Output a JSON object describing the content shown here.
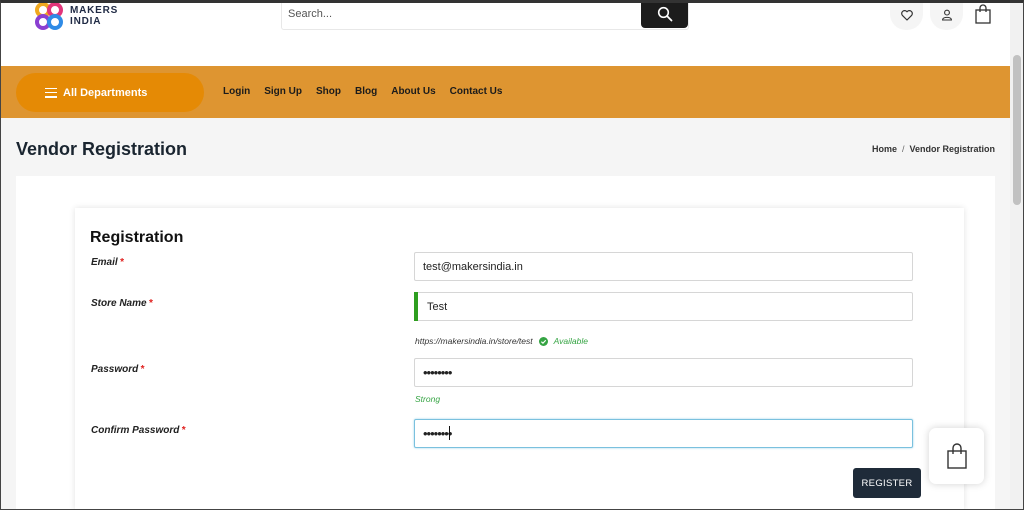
{
  "header": {
    "logo_line1": "MAKERS",
    "logo_line2": "INDIA",
    "search_placeholder": "Search..."
  },
  "nav": {
    "departments_label": "All Departments",
    "links": [
      "Login",
      "Sign Up",
      "Shop",
      "Blog",
      "About Us",
      "Contact Us"
    ]
  },
  "page": {
    "title": "Vendor Registration",
    "breadcrumb": [
      "Home",
      "/",
      "Vendor Registration"
    ]
  },
  "form": {
    "title": "Registration",
    "email_label": "Email",
    "email_value": "test@makersindia.in",
    "store_label": "Store Name",
    "store_value": "Test",
    "store_url": "https://makersindia.in/store/test",
    "store_status": "Available",
    "password_label": "Password",
    "password_value": "••••••••",
    "password_strength": "Strong",
    "confirm_label": "Confirm Password",
    "confirm_value": "••••••••",
    "required_mark": "*",
    "register_label": "REGISTER"
  },
  "colors": {
    "nav_bg": "#de9531",
    "dept_btn": "#e58a05",
    "register_btn": "#1f2b39",
    "success": "#35a443",
    "required": "#e0211f"
  },
  "icons": [
    "logo-icon",
    "search-icon",
    "heart-icon",
    "user-icon",
    "cart-icon",
    "menu-icon",
    "check-circle-icon",
    "shopping-bag-icon"
  ]
}
